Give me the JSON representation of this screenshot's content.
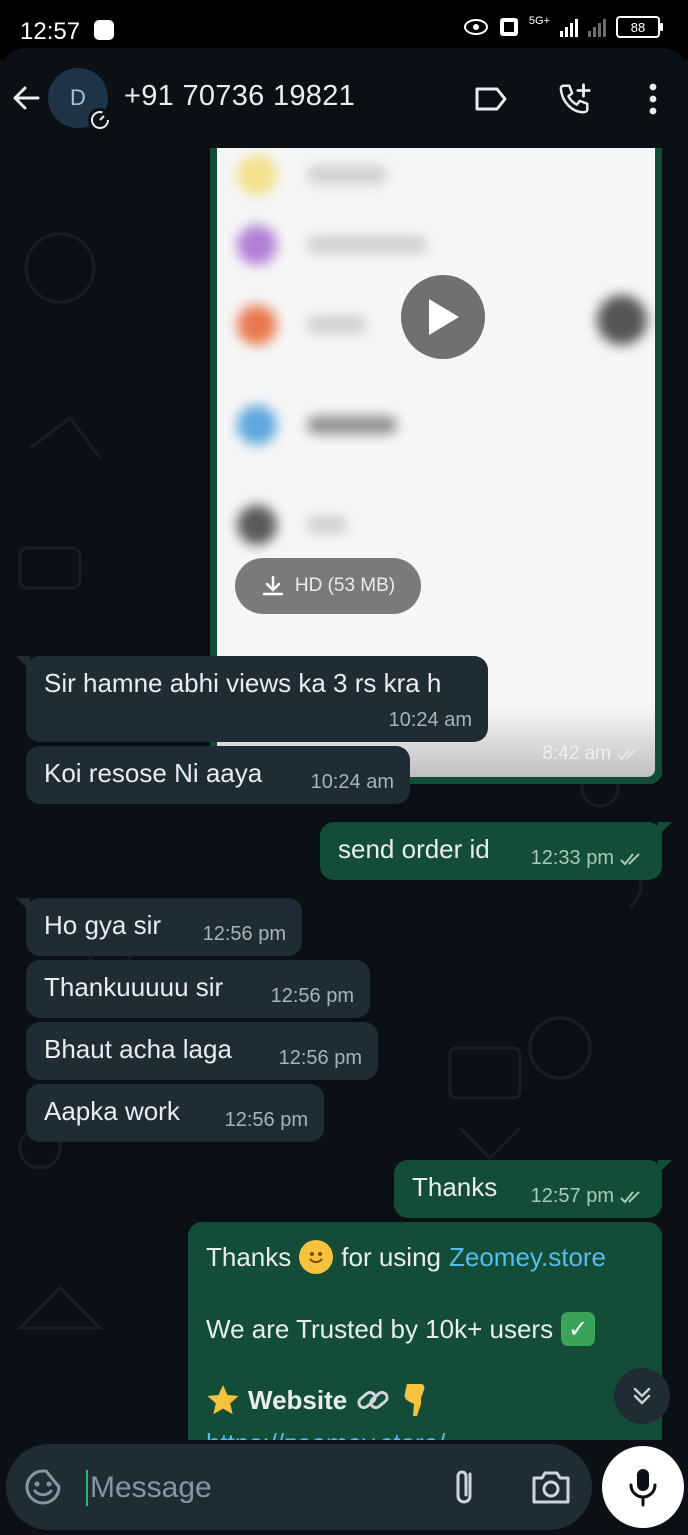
{
  "status_bar": {
    "time": "12:57",
    "battery": "88",
    "network": "5G+"
  },
  "header": {
    "avatar_letter": "D",
    "contact": "+91 70736 19821"
  },
  "video_message": {
    "hd_label": "HD (53 MB)",
    "time": "8:42 am"
  },
  "messages": [
    {
      "text": "Sir hamne abhi views ka 3 rs kra h",
      "time": "10:24 am",
      "direction": "in"
    },
    {
      "text": "Koi resose Ni aaya",
      "time": "10:24 am",
      "direction": "in"
    },
    {
      "text": "send order id",
      "time": "12:33 pm",
      "direction": "out"
    },
    {
      "text": "Ho gya sir",
      "time": "12:56 pm",
      "direction": "in"
    },
    {
      "text": "Thankuuuuu sir",
      "time": "12:56 pm",
      "direction": "in"
    },
    {
      "text": "Bhaut acha laga",
      "time": "12:56 pm",
      "direction": "in"
    },
    {
      "text": "Aapka work",
      "time": "12:56 pm",
      "direction": "in"
    },
    {
      "text": "Thanks",
      "time": "12:57 pm",
      "direction": "out"
    }
  ],
  "promo": {
    "thanks": "Thanks",
    "for_using": "for using",
    "link": "Zeomey.store",
    "trusted": "We are Trusted by 10k+ users",
    "website": "Website",
    "url": "https://zeomey.store/"
  },
  "composer": {
    "placeholder": "Message"
  },
  "colors": {
    "incoming": "#202c33",
    "outgoing": "#144d37",
    "background": "#0b1014",
    "link": "#53bdeb"
  }
}
